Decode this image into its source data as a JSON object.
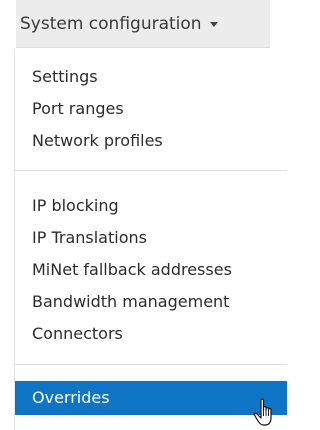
{
  "menu": {
    "trigger_label": "System configuration",
    "trigger_icon": "caret-down-icon",
    "groups": [
      [
        "Settings",
        "Port ranges",
        "Network profiles"
      ],
      [
        "IP blocking",
        "IP Translations",
        "MiNet fallback addresses",
        "Bandwidth management",
        "Connectors"
      ],
      [
        "Overrides"
      ]
    ],
    "active_item": "Overrides"
  },
  "cursor": {
    "icon": "hand-pointer-icon"
  },
  "colors": {
    "trigger_background": "#ececec",
    "active_background": "#0e74c5",
    "active_text": "#ffffff",
    "text": "#2c2c2c"
  }
}
